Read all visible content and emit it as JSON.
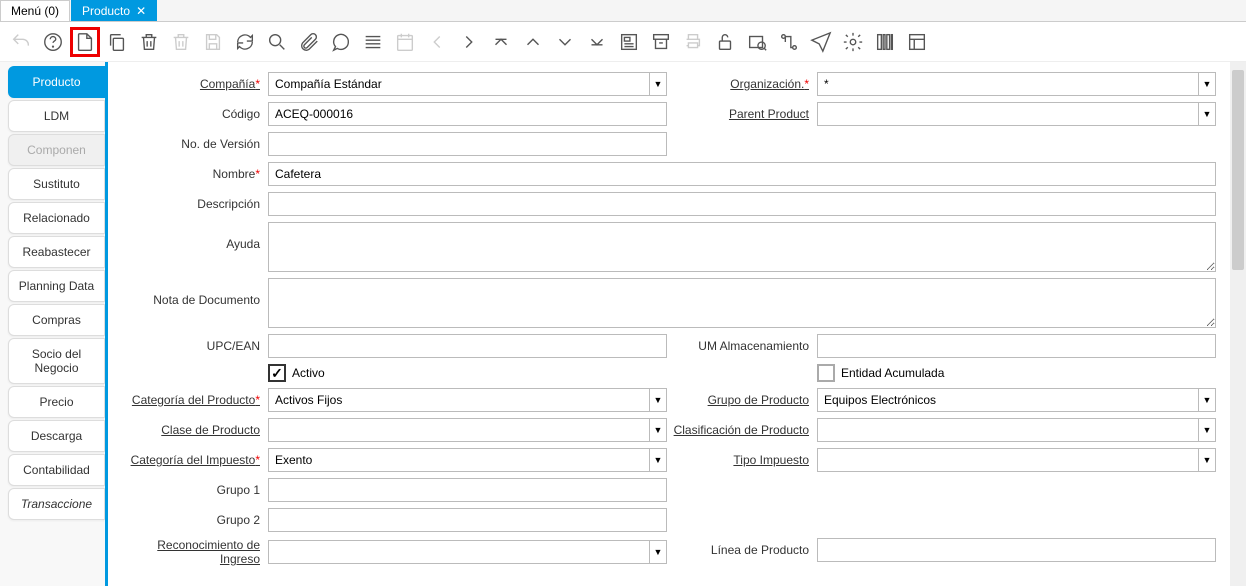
{
  "tabs": {
    "menu": "Menú (0)",
    "producto": "Producto"
  },
  "sidebar": {
    "items": [
      {
        "label": "Producto",
        "active": true
      },
      {
        "label": "LDM"
      },
      {
        "label": "Componen",
        "disabled": true
      },
      {
        "label": "Sustituto"
      },
      {
        "label": "Relacionado"
      },
      {
        "label": "Reabastecer"
      },
      {
        "label": "Planning Data"
      },
      {
        "label": "Compras"
      },
      {
        "label": "Socio del Negocio"
      },
      {
        "label": "Precio"
      },
      {
        "label": "Descarga"
      },
      {
        "label": "Contabilidad"
      },
      {
        "label": "Transaccione",
        "italic": true
      }
    ]
  },
  "labels": {
    "compania": "Compañía",
    "organizacion": "Organización.",
    "codigo": "Código",
    "parent": "Parent Product",
    "noversion": "No. de Versión",
    "nombre": "Nombre",
    "descripcion": "Descripción",
    "ayuda": "Ayuda",
    "notadoc": "Nota de Documento",
    "upc": "UPC/EAN",
    "umalm": "UM Almacenamiento",
    "activo": "Activo",
    "entidad": "Entidad Acumulada",
    "catprod": "Categoría del Producto",
    "grupoprod": "Grupo de Producto",
    "claseprod": "Clase de Producto",
    "clasifprod": "Clasificación de Producto",
    "catimp": "Categoría del Impuesto",
    "tipoimp": "Tipo Impuesto",
    "grupo1": "Grupo 1",
    "grupo2": "Grupo 2",
    "reconoc": "Reconocimiento de Ingreso",
    "linea": "Línea de Producto"
  },
  "values": {
    "compania": "Compañía Estándar",
    "organizacion": "*",
    "codigo": "ACEQ-000016",
    "parent": "",
    "noversion": "",
    "nombre": "Cafetera",
    "descripcion": "",
    "ayuda": "",
    "notadoc": "",
    "upc": "",
    "umalm": "",
    "activo": true,
    "entidad": false,
    "catprod": "Activos Fijos",
    "grupoprod": "Equipos Electrónicos",
    "claseprod": "",
    "clasifprod": "",
    "catimp": "Exento",
    "tipoimp": "",
    "grupo1": "",
    "grupo2": "",
    "reconoc": "",
    "linea": ""
  }
}
